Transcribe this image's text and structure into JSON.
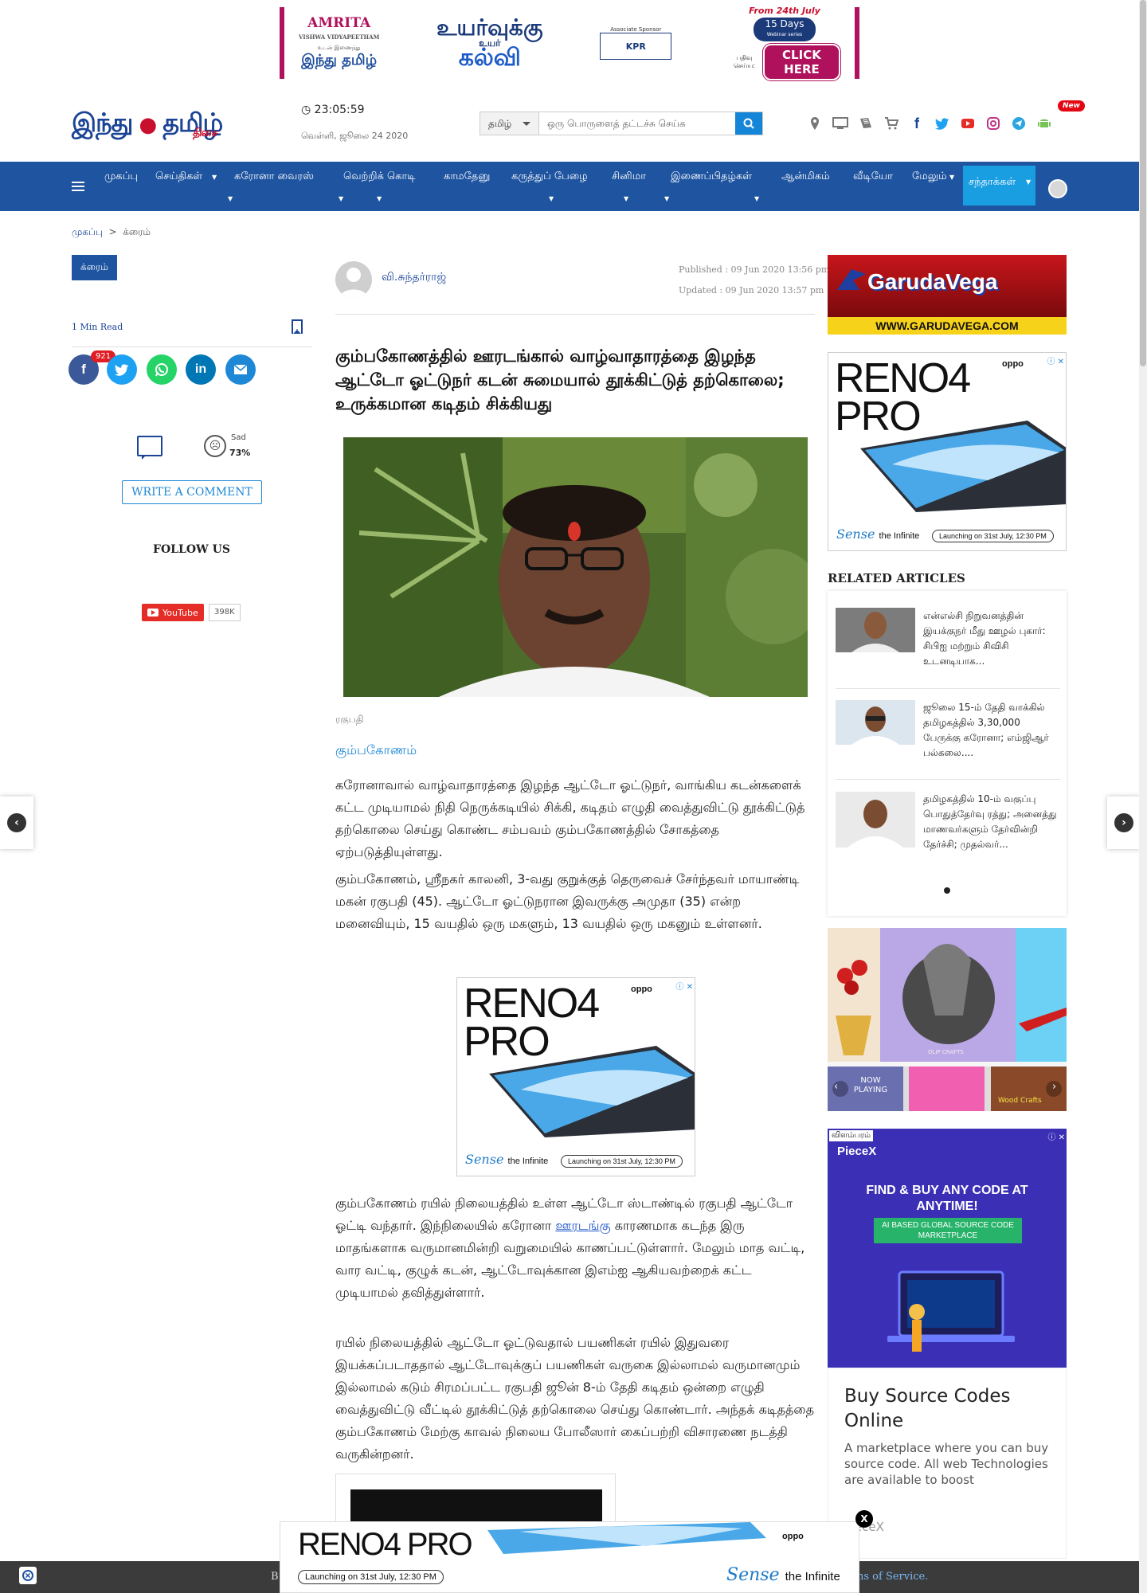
{
  "top_banner": {
    "amrita_name": "AMRITA",
    "amrita_sub": "VISHWA VIDYAPEETHAM",
    "with_label": "உடன் இணைந்து",
    "hindu_tamil": "இந்து தமிழ்",
    "uyarvukku": "உயர்வுக்கு",
    "uyar": "உயர்",
    "kalvi": "கல்வி",
    "sponsor_label": "Associate Sponsor",
    "sponsor_name": "KPR",
    "from_date": "From 24th July",
    "days": "15 Days",
    "series": "Webinar series",
    "register": "பதிவு செய்ய:",
    "click_here": "CLICK HERE"
  },
  "header": {
    "logo_main": "இந்து",
    "logo_tamil": "தமிழ்",
    "logo_sub": "திசை",
    "time": "23:05:59",
    "date": "வெள்ளி, ஜூலை 24 2020",
    "search_lang": "தமிழ்",
    "search_placeholder": "ஒரு பொருளைத் தட்டச்சு செய்க",
    "new_badge": "New"
  },
  "nav": {
    "items": [
      "முகப்பு",
      "செய்திகள்",
      "கரோனா வைரஸ்",
      "வெற்றிக் கொடி",
      "காமதேனு",
      "கருத்துப் பேழை",
      "சினிமா",
      "இணைப்பிதழ்கள்",
      "ஆன்மிகம்",
      "வீடியோ",
      "மேலும்"
    ],
    "subscribe": "சந்தாக்கள்"
  },
  "breadcrumb": {
    "home": "முகப்பு",
    "sep": ">",
    "current": "க்ரைம்"
  },
  "category_tag": "க்ரைம்",
  "min_read": "1 Min Read",
  "share_count": "921",
  "reaction": {
    "label": "Sad",
    "percent": "73%"
  },
  "write_comment": "WRITE A COMMENT",
  "follow_us": "FOLLOW US",
  "youtube": {
    "label": "YouTube",
    "count": "398K"
  },
  "article": {
    "author": "வி.சுந்தர்ராஜ்",
    "published": "Published : 09 Jun 2020 13:56 pm",
    "updated": "Updated : 09 Jun 2020 13:57 pm",
    "headline": "கும்பகோணத்தில் ஊரடங்கால் வாழ்வாதாரத்தை இழந்த ஆட்டோ ஓட்டுநர் கடன் சுமையால் தூக்கிட்டுத் தற்கொலை; உருக்கமான கடிதம் சிக்கியது",
    "caption": "ரகுபதி",
    "place": "கும்பகோணம்",
    "p1": "கரோனாவால் வாழ்வாதாரத்தை இழந்த ஆட்டோ ஓட்டுநர், வாங்கிய கடன்களைக் கட்ட முடியாமல் நிதி நெருக்கடியில் சிக்கி, கடிதம் எழுதி வைத்துவிட்டு தூக்கிட்டுத் தற்கொலை செய்து கொண்ட சம்பவம் கும்பகோணத்தில் சோகத்தை ஏற்படுத்தியுள்ளது.",
    "p2": "கும்பகோணம், ஸ்ரீநகர் காலனி, 3-வது குறுக்குத் தெருவைச் சேர்ந்தவர் மாயாண்டி மகன் ரகுபதி (45). ஆட்டோ ஓட்டுநரான இவருக்கு அமுதா (35) என்ற மனைவியும், 15 வயதில் ஒரு மகளும், 13 வயதில் ஒரு மகனும் உள்ளனர்.",
    "p3_a": "கும்பகோணம் ரயில் நிலையத்தில் உள்ள ஆட்டோ ஸ்டாண்டில் ரகுபதி ஆட்டோ ஓட்டி வந்தார். இந்நிலையில் கரோனா ",
    "p3_link": "ஊரடங்கு",
    "p3_b": " காரணமாக கடந்த இரு மாதங்களாக வருமானமின்றி வறுமையில் காணப்பட்டுள்ளார். மேலும் மாத வட்டி, வார வட்டி, குழுக் கடன், ஆட்டோவுக்கான இஎம்ஐ ஆகியவற்றைக் கட்ட முடியாமல் தவித்துள்ளார்.",
    "p4": "ரயில் நிலையத்தில் ஆட்டோ ஓட்டுவதால் பயணிகள் ரயில் இதுவரை இயக்கப்படாததால் ஆட்டோவுக்குப் பயணிகள் வருகை இல்லாமல் வருமானமும் இல்லாமல் கடும் சிரமப்பட்ட ரகுபதி ஜூன் 8-ம் தேதி கடிதம் ஒன்றை எழுதி வைத்துவிட்டு வீட்டில் தூக்கிட்டுத் தற்கொலை செய்து கொண்டார். அந்தக் கடிதத்தை கும்பகோணம் மேற்கு காவல் நிலைய போலீஸார் கைப்பற்றி விசாரணை நடத்தி வருகின்றனர்."
  },
  "reno_ad": {
    "brand": "oppo",
    "title_1": "RENO4",
    "title_2": "PRO",
    "title_full": "RENO4 PRO",
    "sense": "Sense",
    "infinite": "the Infinite",
    "launch": "Launching on 31st July, 12:30 PM"
  },
  "garuda_ad": {
    "title": "GarudaVega",
    "url": "WWW.GARUDAVEGA.COM"
  },
  "related": {
    "heading": "RELATED ARTICLES",
    "items": [
      {
        "title": "என்எல்சி நிறுவனத்தின் இயக்குநர் மீது ஊழல் புகார்: சிபிஐ மற்றும் சிவிசி உடனடியாக..."
      },
      {
        "title": "ஜூலை 15-ம் தேதி வாக்கில் தமிழகத்தில் 3,30,000 பேருக்கு கரோனா; எம்ஜிஆர் பல்கலை...."
      },
      {
        "title": "தமிழகத்தில் 10-ம் வகுப்பு பொதுத்தேர்வு ரத்து; அனைத்து மாணவர்களும் தேர்வின்றி தேர்ச்சி; முதல்வர்..."
      }
    ]
  },
  "craft_ad": {
    "now_playing": "NOW PLAYING",
    "brand": "OLIP CRAFTS",
    "wood": "Wood Crafts"
  },
  "piece_ad": {
    "label": "விளம்பரம்",
    "brand": "PieceX",
    "headline": "FIND & BUY ANY CODE AT ANYTIME!",
    "tagline": "AI BASED GLOBAL SOURCE CODE MARKETPLACE",
    "title": "Buy Source Codes Online",
    "desc": "A marketplace where you can buy source code. All web Technologies are available to boost"
  },
  "footer": {
    "left": "B",
    "tos": "ns of Service."
  },
  "colors": {
    "nav": "#1e54a0",
    "accent": "#1a9ee2",
    "link": "#1e88d6"
  }
}
